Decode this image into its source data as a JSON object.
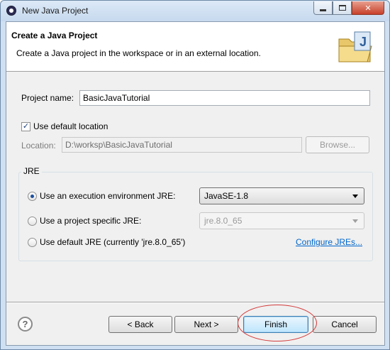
{
  "window": {
    "title": "New Java Project",
    "icon": "eclipse-icon"
  },
  "banner": {
    "title": "Create a Java Project",
    "description": "Create a Java project in the workspace or in an external location.",
    "icon": "java-project-folder-icon"
  },
  "project": {
    "name_label": "Project name:",
    "name_value": "BasicJavaTutorial",
    "use_default_location_label": "Use default location",
    "use_default_location_checked": true,
    "location_label": "Location:",
    "location_value": "D:\\worksp\\BasicJavaTutorial",
    "browse_label": "Browse..."
  },
  "jre": {
    "group_title": "JRE",
    "options": [
      {
        "label": "Use an execution environment JRE:",
        "selected": true,
        "value": "JavaSE-1.8"
      },
      {
        "label": "Use a project specific JRE:",
        "selected": false,
        "value": "jre.8.0_65"
      },
      {
        "label": "Use default JRE (currently 'jre.8.0_65')",
        "selected": false
      }
    ],
    "configure_link": "Configure JREs..."
  },
  "footer": {
    "back_label": "< Back",
    "next_label": "Next >",
    "finish_label": "Finish",
    "cancel_label": "Cancel",
    "help_symbol": "?"
  },
  "annotation": {
    "highlight_color": "#d43c3c"
  }
}
